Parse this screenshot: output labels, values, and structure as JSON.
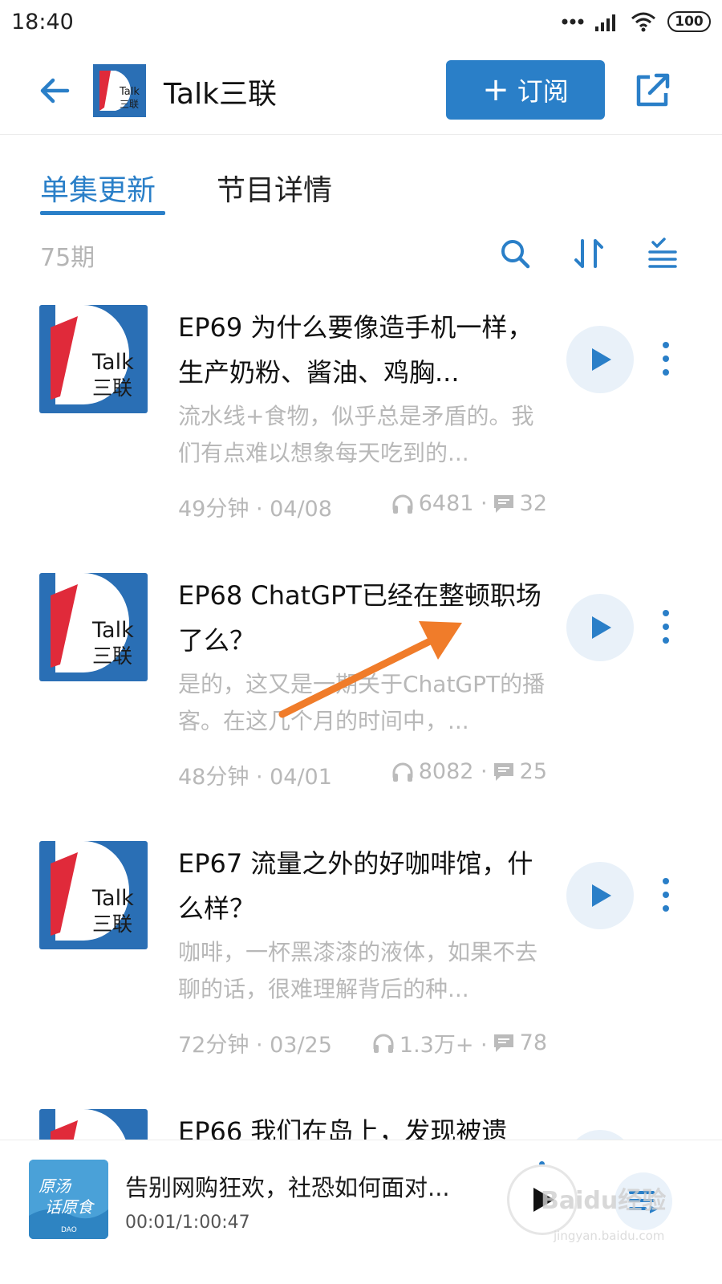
{
  "status_bar": {
    "time": "18:40",
    "battery": "100"
  },
  "header": {
    "title": "Talk三联",
    "subscribe_label": "订阅",
    "logo_text": "Talk",
    "logo_cn": "三联"
  },
  "tabs": [
    {
      "label": "单集更新",
      "active": true
    },
    {
      "label": "节目详情",
      "active": false
    }
  ],
  "toolbar": {
    "episode_count": "75期"
  },
  "episodes": [
    {
      "title": "EP69 为什么要像造手机一样，生产奶粉、酱油、鸡胸...",
      "desc": "流水线+食物，似乎总是矛盾的。我们有点难以想象每天吃到的...",
      "duration_date": "49分钟 · 04/08",
      "plays": "6481 ·",
      "comments": "32"
    },
    {
      "title": "EP68 ChatGPT已经在整顿职场了么？",
      "desc": "是的，这又是一期关于ChatGPT的播客。在这几个月的时间中，...",
      "duration_date": "48分钟 · 04/01",
      "plays": "8082 ·",
      "comments": "25"
    },
    {
      "title": "EP67 流量之外的好咖啡馆，什么样？",
      "desc": "咖啡，一杯黑漆漆的液体，如果不去聊的话，很难理解背后的种...",
      "duration_date": "72分钟 · 03/25",
      "plays": "1.3万+ ·",
      "comments": "78"
    },
    {
      "title": "EP66 我们在岛上，发现被遗",
      "desc": "",
      "duration_date": "",
      "plays": "",
      "comments": ""
    }
  ],
  "player": {
    "title": "告别网购狂欢，社恐如何面对...",
    "time": "00:01/1:00:47",
    "cover_text": "原汤话原食",
    "cover_sub": "DAO"
  },
  "watermark": {
    "main": "Baidu经验",
    "sub": "jingyan.baidu.com"
  },
  "colors": {
    "accent": "#2a7fc8",
    "logo_red": "#e02a3a",
    "logo_blue": "#2a6fb5"
  }
}
